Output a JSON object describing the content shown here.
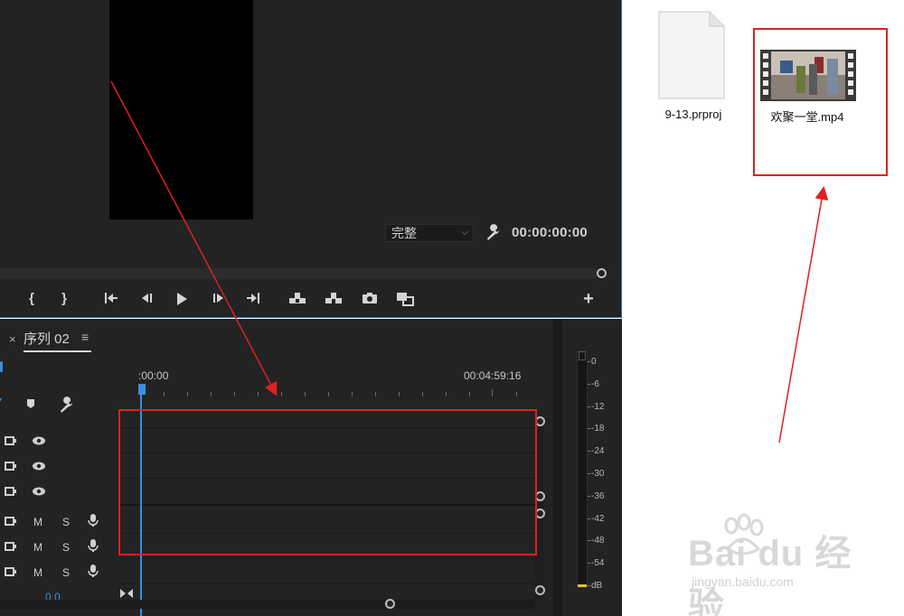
{
  "program_monitor": {
    "fit_select": "完整",
    "timecode": "00:00:00:00",
    "transport": {
      "mark_in": "{",
      "mark_out": "}"
    }
  },
  "timeline": {
    "tab_label": "序列 02",
    "close_glyph": "×",
    "menu_glyph": "≡",
    "ruler_start": ":00:00",
    "ruler_end": "00:04:59:16",
    "audio_track_labels": {
      "mute": "M",
      "solo": "S"
    },
    "bottom_value": "0.0"
  },
  "audio_meter": {
    "labels": [
      "0",
      "-6",
      "-12",
      "-18",
      "-24",
      "-30",
      "-36",
      "-42",
      "-48",
      "-54",
      "dB"
    ]
  },
  "explorer": {
    "files": [
      {
        "name": "9-13.prproj",
        "icon": "document-icon"
      },
      {
        "name": "欢聚一堂.mp4",
        "icon": "video-file-icon"
      }
    ]
  },
  "watermark": {
    "main": "Bai du 经验",
    "sub": "jingyan.baidu.com"
  },
  "colors": {
    "panel_bg": "#232323",
    "accent_blue": "#3c8fe0",
    "annotation_red": "#e02020"
  }
}
